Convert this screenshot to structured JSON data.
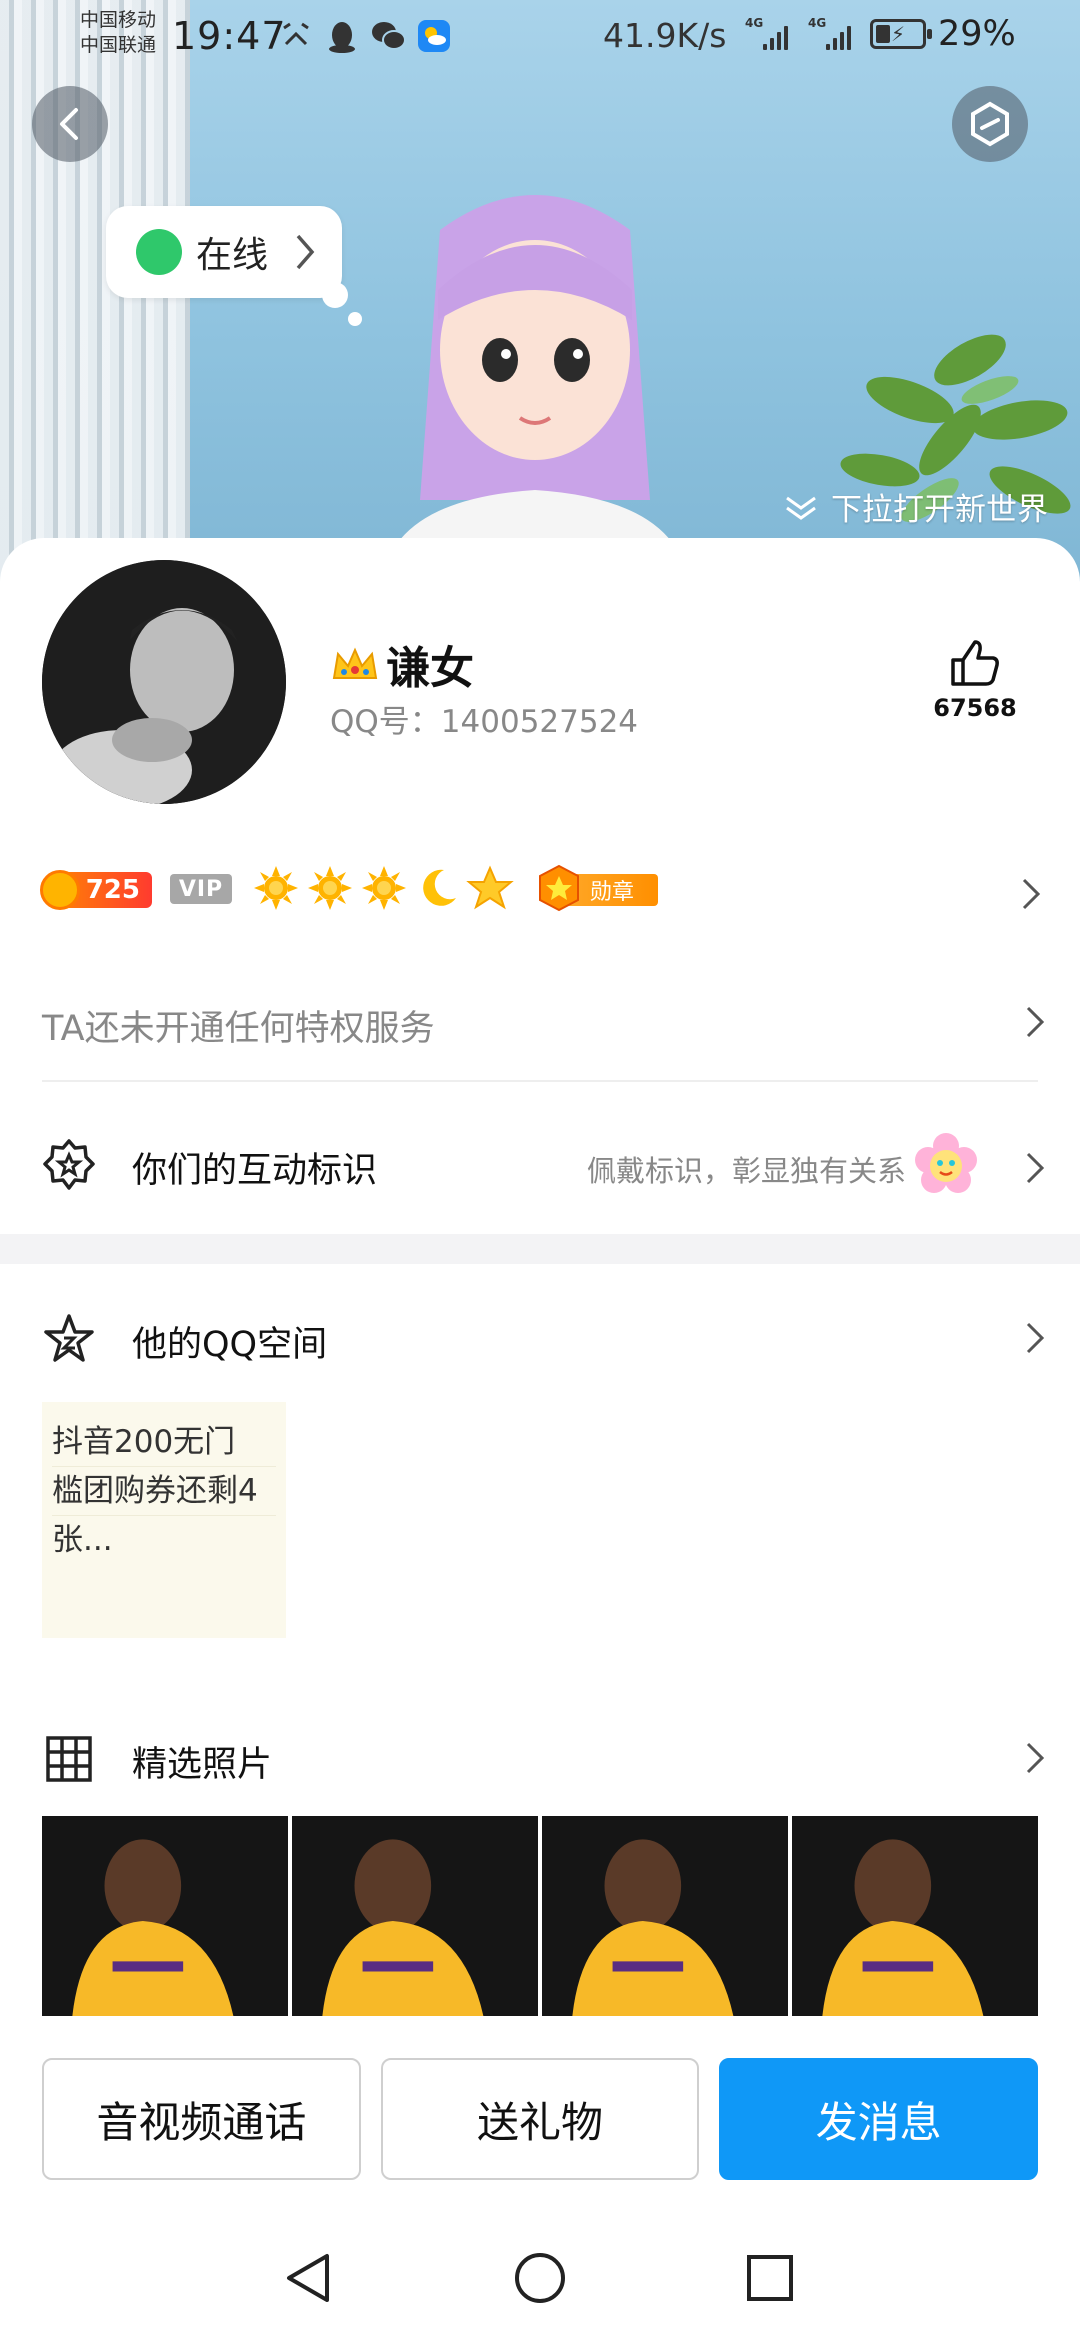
{
  "status_bar": {
    "carrier1": "中国移动",
    "carrier2": "中国联通",
    "time": "19:47",
    "net_speed": "41.9K/s",
    "signal1_label": "4G",
    "signal2_label": "4G",
    "battery": "29%"
  },
  "header": {
    "online_label": "在线",
    "pull_hint": "下拉打开新世界"
  },
  "profile": {
    "nickname": "谦女",
    "qq_number": "QQ号：1400527524",
    "like_count": "67568"
  },
  "badges": {
    "level": "725",
    "vip": "VIP",
    "medal": "勋章"
  },
  "rows": {
    "privilege": "TA还未开通任何特权服务",
    "interact_title": "你们的互动标识",
    "interact_hint": "佩戴标识，彰显独有关系",
    "zone_title": "他的QQ空间",
    "photos_title": "精选照片"
  },
  "zone_post": {
    "line1": "抖音200无门",
    "line2": "槛团购券还剩4",
    "line3": "张..."
  },
  "actions": {
    "call": "音视频通话",
    "gift": "送礼物",
    "message": "发消息"
  },
  "colors": {
    "accent": "#0f98f7",
    "online": "#2fc86b",
    "level_badge": "#ff5a1f"
  }
}
